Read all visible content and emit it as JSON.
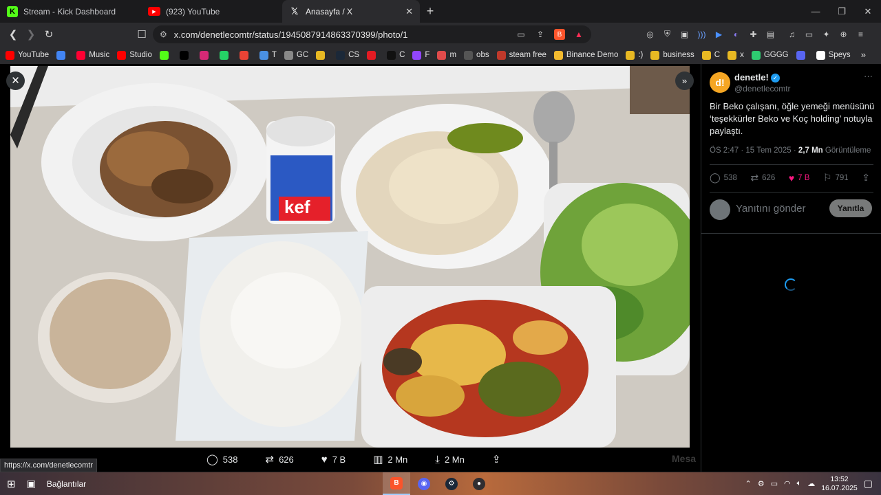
{
  "tabs": [
    {
      "title": "Stream - Kick Dashboard",
      "icon": "kick-icon",
      "color": "#53fc18"
    },
    {
      "title": "(923) YouTube",
      "icon": "youtube-icon",
      "color": "#ff0000"
    },
    {
      "title": "Anasayfa / X",
      "icon": "x-icon",
      "color": "#ffffff"
    }
  ],
  "address": {
    "url": "x.com/denetlecomtr/status/1945087914863370399/photo/1"
  },
  "bookmarks": [
    {
      "label": "YouTube",
      "icon": "youtube-icon",
      "color": "#ff0000"
    },
    {
      "label": "",
      "icon": "drive-icon",
      "color": "#4285f4"
    },
    {
      "label": "Music",
      "icon": "youtube-music-icon",
      "color": "#ff0033"
    },
    {
      "label": "Studio",
      "icon": "youtube-studio-icon",
      "color": "#ff0000"
    },
    {
      "label": "",
      "icon": "kick-icon",
      "color": "#53fc18"
    },
    {
      "label": "",
      "icon": "x-icon",
      "color": "#000000"
    },
    {
      "label": "",
      "icon": "instagram-icon",
      "color": "#d62976"
    },
    {
      "label": "",
      "icon": "whatsapp-icon",
      "color": "#25d366"
    },
    {
      "label": "",
      "icon": "gmail-icon",
      "color": "#ea4335"
    },
    {
      "label": "T",
      "icon": "cursor-icon",
      "color": "#4a90e2"
    },
    {
      "label": "GC",
      "icon": "globe-icon",
      "color": "#888888"
    },
    {
      "label": "",
      "icon": "folder-yellow-icon",
      "color": "#e8b923"
    },
    {
      "label": "CS",
      "icon": "steam-icon",
      "color": "#1b2838"
    },
    {
      "label": "",
      "icon": "red-square-icon",
      "color": "#e31b23"
    },
    {
      "label": "C",
      "icon": "tiktok-icon",
      "color": "#111111"
    },
    {
      "label": "F",
      "icon": "twitch-icon",
      "color": "#9146ff"
    },
    {
      "label": "m",
      "icon": "m-icon",
      "color": "#e04b4b"
    },
    {
      "label": "obs",
      "icon": "obs-icon",
      "color": "#555555"
    },
    {
      "label": "steam free",
      "icon": "drop-icon",
      "color": "#c0392b"
    },
    {
      "label": "Binance Demo",
      "icon": "binance-icon",
      "color": "#f3ba2f"
    },
    {
      "label": ":)",
      "icon": "folder-icon",
      "color": "#e8b923"
    },
    {
      "label": "business",
      "icon": "folder-icon",
      "color": "#e8b923"
    },
    {
      "label": "C",
      "icon": "folder-icon",
      "color": "#e8b923"
    },
    {
      "label": "x",
      "icon": "folder-icon",
      "color": "#e8b923"
    },
    {
      "label": "GGGG",
      "icon": "leaf-icon",
      "color": "#2ecc71"
    },
    {
      "label": "",
      "icon": "circle-icon",
      "color": "#5865f2"
    },
    {
      "label": "Speys",
      "icon": "speys-icon",
      "color": "#ffffff"
    }
  ],
  "post_actions": {
    "replies": "538",
    "reposts": "626",
    "likes": "7 B",
    "views": "2 Mn",
    "downloads": "2 Mn"
  },
  "side_overlay_text": "Mesa",
  "status_url": "https://x.com/denetlecomtr",
  "tweet": {
    "name": "denetle!",
    "handle": "@denetlecomtr",
    "avatar_text": "d!",
    "text": "Bir Beko çalışanı, öğle yemeği menüsünü ‘teşekkürler Beko ve Koç holding’ notuyla paylaştı.",
    "time": "ÖS 2:47 · 15 Tem 2025 · ",
    "views_count": "2,7 Mn",
    "views_label": "Görüntüleme",
    "replies": "538",
    "reposts": "626",
    "likes": "7 B",
    "bookmarks": "791",
    "reply_placeholder": "Yanıtını gönder",
    "reply_button": "Yanıtla"
  },
  "photo_labels": {
    "cup_text": "kef"
  },
  "taskbar": {
    "widgets_label": "Bağlantılar",
    "time": "13:52",
    "date": "16.07.2025"
  },
  "accent": {
    "x_blue": "#1d9bf0",
    "like_pink": "#f91880"
  }
}
